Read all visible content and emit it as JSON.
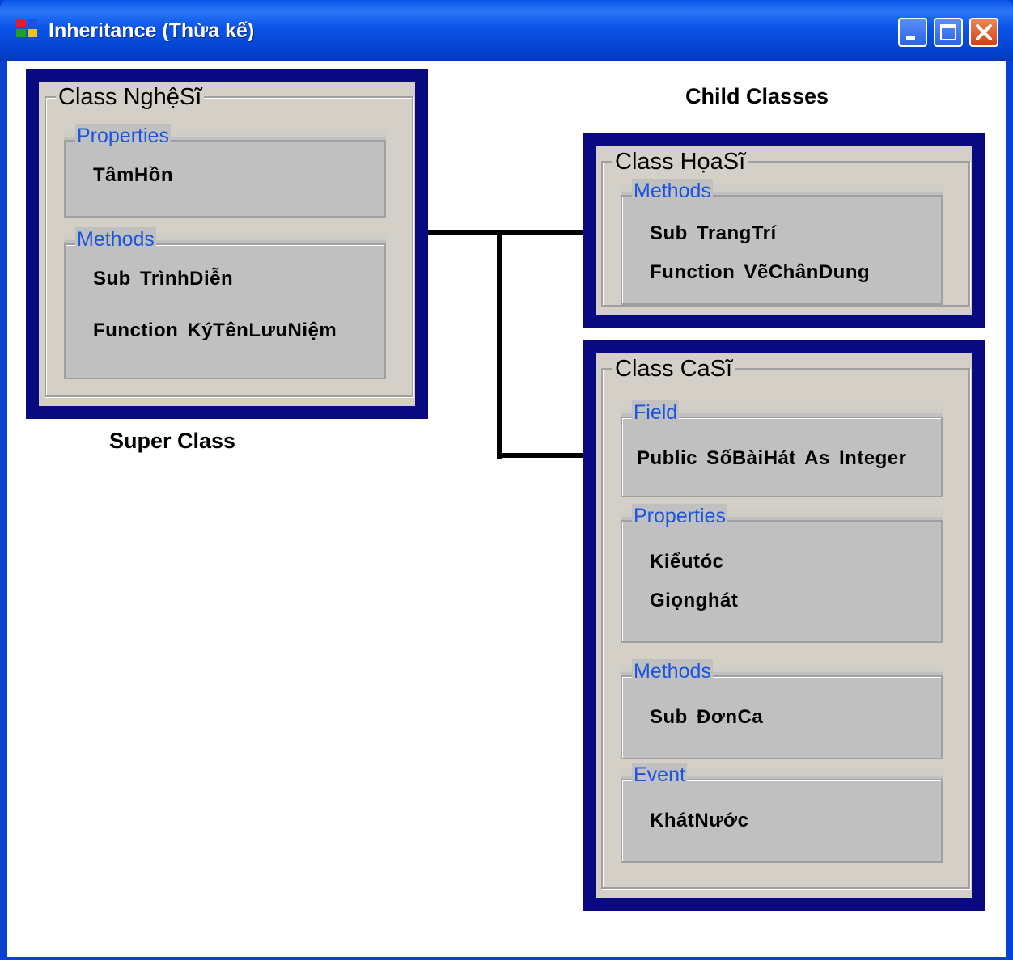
{
  "window": {
    "title": "Inheritance (Thừa kế)"
  },
  "captions": {
    "super": "Super Class",
    "children": "Child Classes"
  },
  "classes": {
    "nghesi": {
      "name": "Class NghệSĩ",
      "properties": {
        "label": "Properties",
        "items": [
          "TâmHồn"
        ]
      },
      "methods": {
        "label": "Methods",
        "items": [
          "Sub TrìnhDiễn",
          "Function KýTênLưuNiệm"
        ]
      }
    },
    "hoasi": {
      "name": "Class HọaSĩ",
      "methods": {
        "label": "Methods",
        "items": [
          "Sub TrangTrí",
          "Function VẽChânDung"
        ]
      }
    },
    "casi": {
      "name": "Class CaSĩ",
      "field": {
        "label": "Field",
        "items": [
          "Public SốBàiHát As Integer"
        ]
      },
      "properties": {
        "label": "Properties",
        "items": [
          "Kiểutóc",
          "Giọnghát"
        ]
      },
      "methods": {
        "label": "Methods",
        "items": [
          "Sub ĐơnCa"
        ]
      },
      "event": {
        "label": "Event",
        "items": [
          "KhátNước"
        ]
      }
    }
  },
  "colors": {
    "frame": "#0a0a80",
    "panel": "#d4d0c8",
    "section": "#c0c0c0",
    "section_title": "#1a55e0",
    "titlebar": "#0a55e8"
  },
  "icons": [
    "app-form-icon",
    "minimize-icon",
    "maximize-icon",
    "close-icon"
  ]
}
